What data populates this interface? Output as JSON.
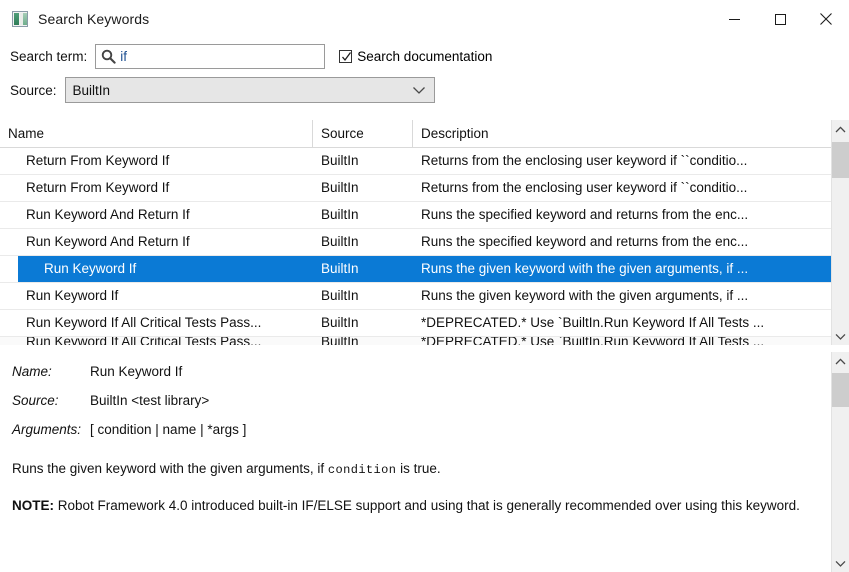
{
  "window": {
    "title": "Search Keywords",
    "icon": "app-icon",
    "controls": {
      "minimize": "minimize",
      "maximize": "maximize",
      "close": "close"
    }
  },
  "search": {
    "label": "Search term:",
    "value": "if",
    "placeholder": "",
    "icon": "search-icon",
    "checkbox": {
      "label": "Search documentation",
      "checked": true
    }
  },
  "source": {
    "label": "Source:",
    "selected": "BuiltIn",
    "options": [
      "BuiltIn"
    ]
  },
  "table": {
    "columns": [
      "Name",
      "Source",
      "Description"
    ],
    "rows": [
      {
        "name": "Return From Keyword If",
        "source": "BuiltIn",
        "description": "Returns from the enclosing user keyword if ``conditio...",
        "selected": false
      },
      {
        "name": "Return From Keyword If",
        "source": "BuiltIn",
        "description": "Returns from the enclosing user keyword if ``conditio...",
        "selected": false
      },
      {
        "name": "Run Keyword And Return If",
        "source": "BuiltIn",
        "description": "Runs the specified keyword and returns from the enc...",
        "selected": false
      },
      {
        "name": "Run Keyword And Return If",
        "source": "BuiltIn",
        "description": "Runs the specified keyword and returns from the enc...",
        "selected": false
      },
      {
        "name": "Run Keyword If",
        "source": "BuiltIn",
        "description": "Runs the given keyword with the given arguments, if ...",
        "selected": true
      },
      {
        "name": "Run Keyword If",
        "source": "BuiltIn",
        "description": "Runs the given keyword with the given arguments, if ...",
        "selected": false
      },
      {
        "name": "Run Keyword If All Critical Tests Pass...",
        "source": "BuiltIn",
        "description": "*DEPRECATED.* Use `BuiltIn.Run Keyword If All Tests ...",
        "selected": false
      },
      {
        "name": "Run Keyword If All Critical Tests Pass...",
        "source": "BuiltIn",
        "description": "*DEPRECATED.* Use `BuiltIn.Run Keyword If All Tests ...",
        "selected": false
      }
    ]
  },
  "detail": {
    "name_label": "Name:",
    "name_value": "Run Keyword If",
    "source_label": "Source:",
    "source_value": "BuiltIn <test library>",
    "arguments_label": "Arguments:",
    "arguments_value": "[ condition | name | *args ]",
    "summary_pre": "Runs the given keyword with the given arguments, if ",
    "summary_code": "condition",
    "summary_post": " is true.",
    "note_label": "NOTE:",
    "note_text": " Robot Framework 4.0 introduced built-in IF/ELSE support and using that is generally recommended over using this keyword."
  },
  "colors": {
    "selection": "#0b7ad5",
    "selection_text": "#ffffff",
    "search_text": "#1d4f91",
    "scrollbar_thumb": "#cdcdcd",
    "scrollbar_track": "#f0f0f0"
  },
  "scrollbars": {
    "list": {
      "up": "chevron-up-icon",
      "down": "chevron-down-icon"
    },
    "detail": {
      "up": "chevron-up-icon",
      "down": "chevron-down-icon"
    }
  }
}
